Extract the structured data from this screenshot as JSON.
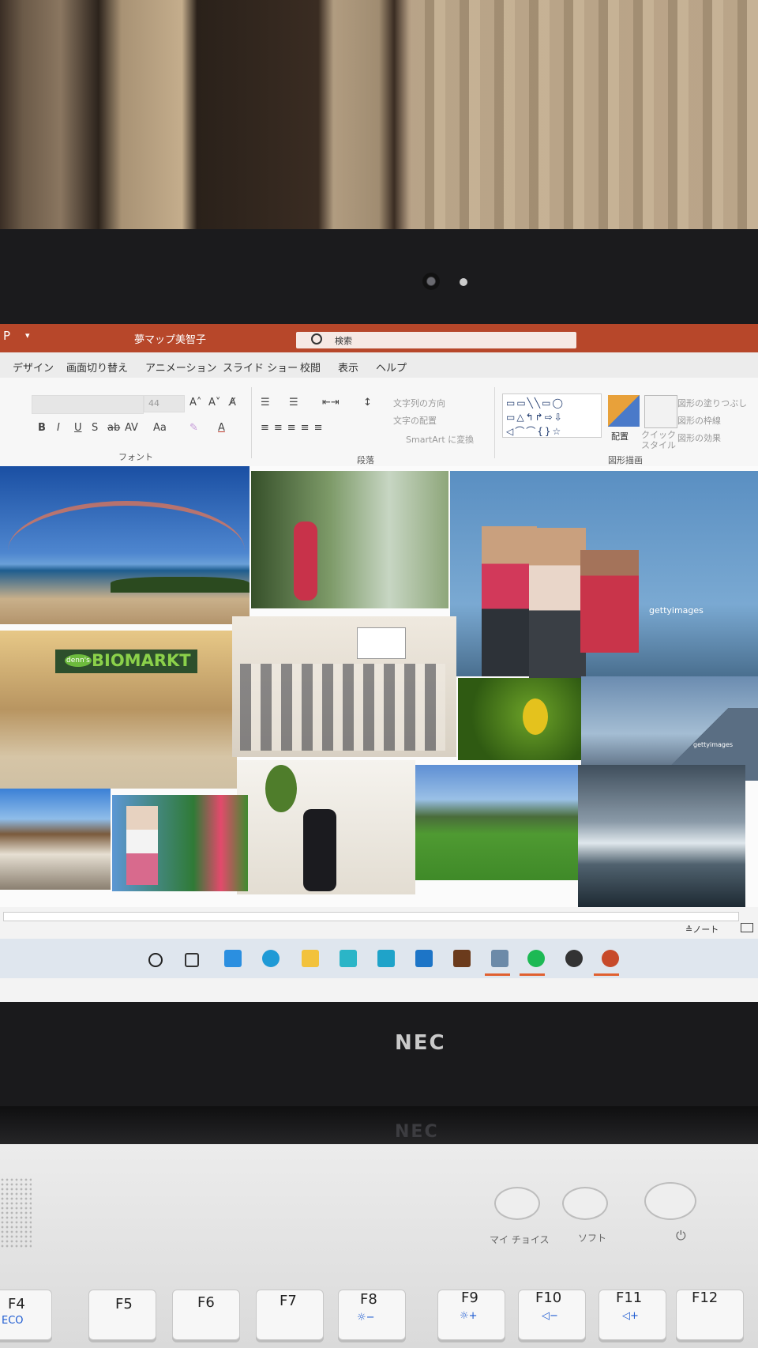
{
  "window": {
    "app_icon": "P",
    "title": "夢マップ美智子",
    "title_dropdown": "▾",
    "search_placeholder": "検索"
  },
  "tabs": [
    "デザイン",
    "画面切り替え",
    "アニメーション",
    "スライド ショー",
    "校閲",
    "表示",
    "ヘルプ"
  ],
  "ribbon": {
    "font_size": "44",
    "font_buttons": [
      "B",
      "I",
      "U",
      "S",
      "ab",
      "AV",
      "Aa",
      "A"
    ],
    "paragraph_items": [
      "文字列の方向",
      "文字の配置",
      "SmartArt に変換"
    ],
    "arrange_label": "配置",
    "quick_style_label": "クイック\nスタイル",
    "shape_fill": "図形の塗りつぶし",
    "shape_outline": "図形の枠線",
    "shape_effects": "図形の効果",
    "groups": {
      "font": "フォント",
      "paragraph": "段落",
      "drawing": "図形描画"
    }
  },
  "collage": {
    "store_sign": "BIOMARKT",
    "store_badge": "denn's",
    "watermark_1": "gettyimages",
    "watermark_2": "gettyimages"
  },
  "statusbar": {
    "notes_label": "≙ノート"
  },
  "taskbar": {
    "icons": [
      "search-icon",
      "task-view-icon",
      "photos-icon",
      "edge-icon",
      "file-explorer-icon",
      "app-icon",
      "app-icon-2",
      "mail-icon",
      "app-icon-3",
      "app-icon-4",
      "spotify-icon",
      "app-icon-5",
      "powerpoint-icon"
    ]
  },
  "laptop": {
    "brand": "NEC",
    "buttons": [
      "マイ チョイス",
      "ソフト",
      "⏻"
    ]
  },
  "keys": [
    {
      "label": "F4",
      "sub": "ECO"
    },
    {
      "label": "F5",
      "sub": ""
    },
    {
      "label": "F6",
      "sub": ""
    },
    {
      "label": "F7",
      "sub": ""
    },
    {
      "label": "F8",
      "sub": "☼−"
    },
    {
      "label": "F9",
      "sub": "☼+"
    },
    {
      "label": "F10",
      "sub": "◁−"
    },
    {
      "label": "F11",
      "sub": "◁+"
    },
    {
      "label": "F12",
      "sub": ""
    }
  ],
  "colors": {
    "accent": "#b7472a",
    "taskbar": "#dfe6ee",
    "deck": "#e4e4e4"
  }
}
